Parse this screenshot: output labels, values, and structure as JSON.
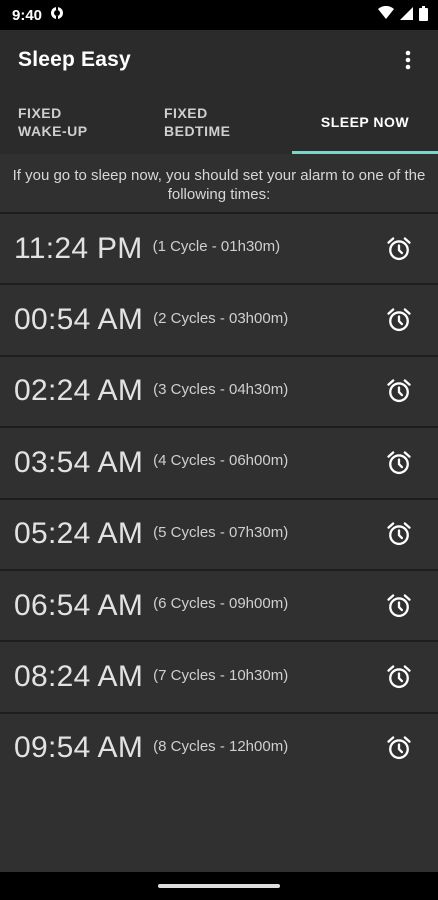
{
  "status_bar": {
    "time": "9:40"
  },
  "app_bar": {
    "title": "Sleep Easy"
  },
  "tabs": [
    {
      "line1": "FIXED",
      "line2": "WAKE-UP"
    },
    {
      "line1": "FIXED",
      "line2": "BEDTIME"
    },
    {
      "label": "SLEEP NOW",
      "selected": true
    }
  ],
  "intro_text": "If you go to sleep now, you should set your alarm to one of the following times:",
  "alarms": [
    {
      "time": "11:24 PM",
      "cycles": "(1 Cycle - 01h30m)"
    },
    {
      "time": "00:54 AM",
      "cycles": "(2 Cycles - 03h00m)"
    },
    {
      "time": "02:24 AM",
      "cycles": "(3 Cycles - 04h30m)"
    },
    {
      "time": "03:54 AM",
      "cycles": "(4 Cycles - 06h00m)"
    },
    {
      "time": "05:24 AM",
      "cycles": "(5 Cycles - 07h30m)"
    },
    {
      "time": "06:54 AM",
      "cycles": "(6 Cycles - 09h00m)"
    },
    {
      "time": "08:24 AM",
      "cycles": "(7 Cycles - 10h30m)"
    },
    {
      "time": "09:54 AM",
      "cycles": "(8 Cycles - 12h00m)"
    }
  ],
  "colors": {
    "accent": "#7fd3c8",
    "app_bar": "#2b2b2b",
    "background": "#303030"
  },
  "icons": {
    "row_action": "alarm-clock-icon",
    "menu": "more-vert-icon"
  }
}
